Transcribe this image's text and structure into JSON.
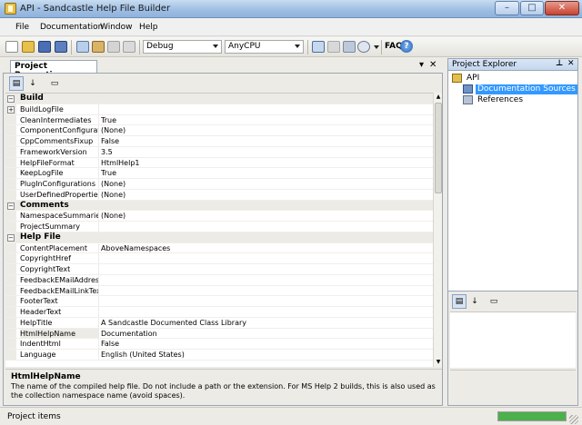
{
  "window": {
    "title": "API - Sandcastle Help File Builder",
    "controls": {
      "minimize": "–",
      "maximize": "□",
      "close": "✕"
    }
  },
  "menu": {
    "items": [
      "File",
      "Documentation",
      "Window",
      "Help"
    ]
  },
  "toolbar": {
    "configuration": "Debug",
    "platform": "AnyCPU",
    "faq": "FAQ",
    "help_icon": "?"
  },
  "properties_window": {
    "tab": "Project Properties",
    "tab_controls": {
      "dropdown": "▾",
      "close": "✕"
    },
    "sort_categorized_icon": "categorized-icon",
    "sort_alpha_icon": "az-icon",
    "property_pages_icon": "pages-icon",
    "rows": [
      {
        "kind": "category",
        "name": "Build",
        "expander": "−"
      },
      {
        "kind": "prop",
        "name": "BuildLogFile",
        "value": "",
        "expander": "+"
      },
      {
        "kind": "prop",
        "name": "CleanIntermediates",
        "value": "True"
      },
      {
        "kind": "prop",
        "name": "ComponentConfigurations",
        "value": "(None)"
      },
      {
        "kind": "prop",
        "name": "CppCommentsFixup",
        "value": "False"
      },
      {
        "kind": "prop",
        "name": "FrameworkVersion",
        "value": "3.5"
      },
      {
        "kind": "prop",
        "name": "HelpFileFormat",
        "value": "HtmlHelp1"
      },
      {
        "kind": "prop",
        "name": "KeepLogFile",
        "value": "True"
      },
      {
        "kind": "prop",
        "name": "PlugInConfigurations",
        "value": "(None)"
      },
      {
        "kind": "prop",
        "name": "UserDefinedProperties",
        "value": "(None)"
      },
      {
        "kind": "category",
        "name": "Comments",
        "expander": "−"
      },
      {
        "kind": "prop",
        "name": "NamespaceSummaries",
        "value": "(None)"
      },
      {
        "kind": "prop",
        "name": "ProjectSummary",
        "value": ""
      },
      {
        "kind": "category",
        "name": "Help File",
        "expander": "−"
      },
      {
        "kind": "prop",
        "name": "ContentPlacement",
        "value": "AboveNamespaces"
      },
      {
        "kind": "prop",
        "name": "CopyrightHref",
        "value": ""
      },
      {
        "kind": "prop",
        "name": "CopyrightText",
        "value": ""
      },
      {
        "kind": "prop",
        "name": "FeedbackEMailAddress",
        "value": ""
      },
      {
        "kind": "prop",
        "name": "FeedbackEMailLinkText",
        "value": ""
      },
      {
        "kind": "prop",
        "name": "FooterText",
        "value": ""
      },
      {
        "kind": "prop",
        "name": "HeaderText",
        "value": ""
      },
      {
        "kind": "prop",
        "name": "HelpTitle",
        "value": "A Sandcastle Documented Class Library"
      },
      {
        "kind": "prop",
        "name": "HtmlHelpName",
        "value": "Documentation",
        "selected": true
      },
      {
        "kind": "prop",
        "name": "IndentHtml",
        "value": "False"
      },
      {
        "kind": "prop",
        "name": "Language",
        "value": "English (United States)"
      }
    ],
    "description": {
      "title": "HtmlHelpName",
      "text": "The name of the compiled help file.  Do not include a path or the extension.  For MS Help 2 builds, this is also used as the collection namespace name (avoid spaces)."
    }
  },
  "project_explorer": {
    "title": "Project Explorer",
    "controls": {
      "pin": "⊥",
      "close": "✕"
    },
    "root": "API",
    "items": [
      {
        "label": "Documentation Sources",
        "selected": true
      },
      {
        "label": "References",
        "selected": false
      }
    ]
  },
  "status": {
    "text": "Project items",
    "progress": 1.0
  },
  "colors": {
    "selection": "#3399ff",
    "progress": "#4cb04c"
  }
}
